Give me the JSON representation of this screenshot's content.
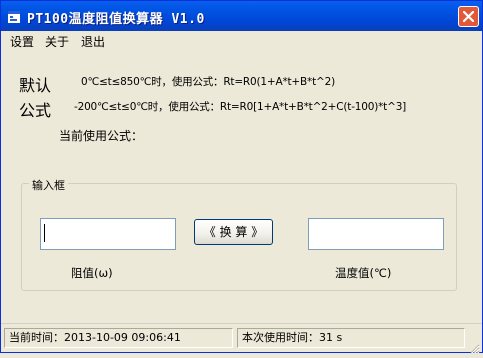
{
  "window": {
    "title": "PT100温度阻值换算器 V1.0",
    "close_glyph": "✕"
  },
  "menu": {
    "items": [
      "设置",
      "关于",
      "退出"
    ]
  },
  "defaults": {
    "label_line1": "默认",
    "label_line2": "公式",
    "formula1": "0℃≤t≤850℃时，使用公式：Rt=R0(1+A*t+B*t^2)",
    "formula2": "-200℃≤t≤0℃时，使用公式：Rt=R0[1+A*t+B*t^2+C(t-100)*t^3]"
  },
  "current_formula": {
    "label": "当前使用公式："
  },
  "input_group": {
    "title": "输入框",
    "resistance_value": "",
    "temperature_value": "",
    "convert_label": "《 换 算 》",
    "resistance_caption": "阻值(ω)",
    "temperature_caption": "温度值(℃)"
  },
  "statusbar": {
    "current_time": "当前时间：2013-10-09 09:06:41",
    "usage_time": "本次使用时间：31 s"
  },
  "colors": {
    "titlebar": "#0054e3",
    "window_bg": "#ece9d8",
    "close_button": "#e2593a",
    "input_border": "#7f9db9"
  },
  "icons": [
    "app-icon",
    "close-icon",
    "size-grip-icon"
  ]
}
